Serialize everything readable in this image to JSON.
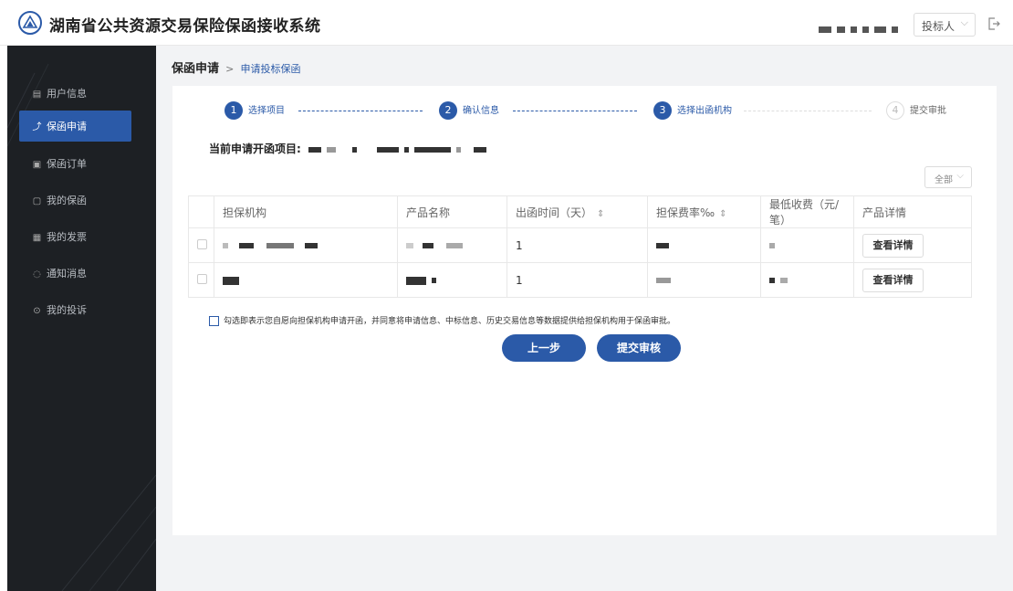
{
  "header": {
    "app_title": "湖南省公共资源交易保险保函接收系统",
    "role_select_value": "投标人",
    "logo_icon": "shield-logo-icon",
    "logout_icon": "logout-icon"
  },
  "sidebar": {
    "items": [
      {
        "label": "用户信息",
        "icon": "user-card-icon",
        "active": false
      },
      {
        "label": "保函申请",
        "icon": "apply-icon",
        "active": true
      },
      {
        "label": "保函订单",
        "icon": "order-icon",
        "active": false
      },
      {
        "label": "我的保函",
        "icon": "document-icon",
        "active": false
      },
      {
        "label": "我的发票",
        "icon": "invoice-icon",
        "active": false
      },
      {
        "label": "通知消息",
        "icon": "message-icon",
        "active": false
      },
      {
        "label": "我的投诉",
        "icon": "complaint-icon",
        "active": false
      }
    ]
  },
  "breadcrumb": {
    "root": "保函申请",
    "separator": ">",
    "current": "申请投标保函"
  },
  "steps": [
    {
      "num": "1",
      "label": "选择项目",
      "done": true
    },
    {
      "num": "2",
      "label": "确认信息",
      "done": true
    },
    {
      "num": "3",
      "label": "选择出函机构",
      "done": true
    },
    {
      "num": "4",
      "label": "提交审批",
      "done": false
    }
  ],
  "project": {
    "label": "当前申请开函项目:"
  },
  "filter": {
    "value": "全部"
  },
  "table": {
    "headers": [
      "担保机构",
      "产品名称",
      "出函时间（天）",
      "担保费率‰",
      "最低收费（元/笔）",
      "产品详情"
    ],
    "rows": [
      {
        "days": "1",
        "detail_label": "查看详情"
      },
      {
        "days": "1",
        "detail_label": "查看详情"
      }
    ]
  },
  "agreement": {
    "text": "勾选即表示您自愿向担保机构申请开函，并同意将申请信息、中标信息、历史交易信息等数据提供给担保机构用于保函审批。"
  },
  "actions": {
    "prev_label": "上一步",
    "submit_label": "提交审核"
  },
  "colors": {
    "accent": "#2b5aa8",
    "sidebar_bg": "#1d2024"
  }
}
